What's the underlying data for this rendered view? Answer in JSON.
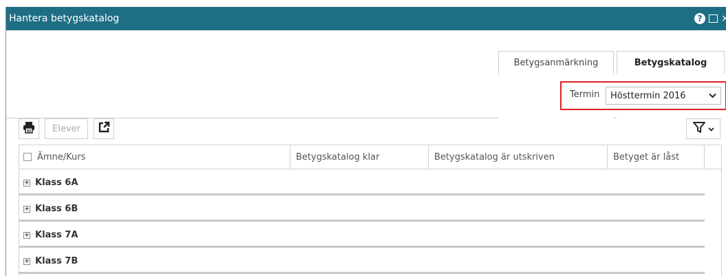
{
  "window": {
    "title": "Hantera betygskatalog",
    "help_icon": "question-circle-icon",
    "maximize_icon": "maximize-icon",
    "close_icon": "close-icon"
  },
  "tabs": [
    {
      "label": "Betygsanmärkning",
      "active": false
    },
    {
      "label": "Betygskatalog",
      "active": true
    }
  ],
  "termin": {
    "label": "Termin",
    "value": "Hösttermin 2016"
  },
  "toolbar": {
    "print_icon": "print-icon",
    "elever_label": "Elever",
    "export_icon": "export-icon",
    "filter_icon": "filter-icon"
  },
  "grid": {
    "columns": [
      "Ämne/Kurs",
      "Betygskatalog klar",
      "Betygskatalog är utskriven",
      "Betyget är låst"
    ],
    "groups": [
      "Klass 6A",
      "Klass 6B",
      "Klass 7A",
      "Klass 7B"
    ]
  },
  "colors": {
    "titlebar": "#1f6f84",
    "highlight": "#e02020"
  }
}
